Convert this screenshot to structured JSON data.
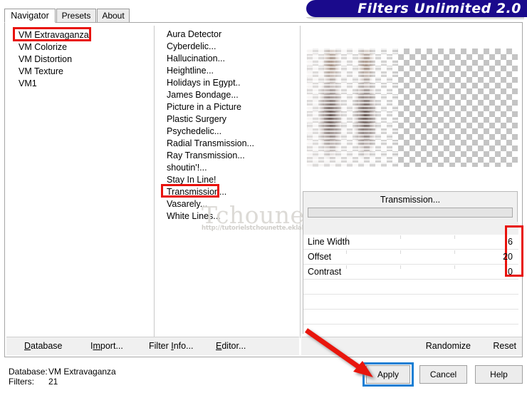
{
  "app": {
    "title": "Filters Unlimited 2.0"
  },
  "tabs": [
    {
      "label": "Navigator",
      "active": true
    },
    {
      "label": "Presets",
      "active": false
    },
    {
      "label": "About",
      "active": false
    }
  ],
  "databases": {
    "items": [
      {
        "label": "VM Extravaganza",
        "selected": true
      },
      {
        "label": "VM Colorize",
        "selected": false
      },
      {
        "label": "VM Distortion",
        "selected": false
      },
      {
        "label": "VM Texture",
        "selected": false
      },
      {
        "label": "VM1",
        "selected": false
      }
    ]
  },
  "filters": {
    "items": [
      {
        "label": "Aura Detector",
        "selected": false
      },
      {
        "label": "Cyberdelic...",
        "selected": false
      },
      {
        "label": "Hallucination...",
        "selected": false
      },
      {
        "label": "Heightline...",
        "selected": false
      },
      {
        "label": "Holidays in Egypt..",
        "selected": false
      },
      {
        "label": "James Bondage...",
        "selected": false
      },
      {
        "label": "Picture in a Picture",
        "selected": false
      },
      {
        "label": "Plastic Surgery",
        "selected": false
      },
      {
        "label": "Psychedelic...",
        "selected": false
      },
      {
        "label": "Radial Transmission...",
        "selected": false
      },
      {
        "label": "Ray Transmission...",
        "selected": false
      },
      {
        "label": "shoutin'!...",
        "selected": false
      },
      {
        "label": "Stay In Line!",
        "selected": false
      },
      {
        "label": "Transmission...",
        "selected": true
      },
      {
        "label": "Vasarely...",
        "selected": false
      },
      {
        "label": "White Lines...",
        "selected": false
      }
    ]
  },
  "preview": {
    "alt": "filtered image preview with transparency checkerboard"
  },
  "watermark": {
    "name": "Tchounette",
    "url": "http://tutorielstchounette.eklablog.com"
  },
  "parameters": {
    "title": "Transmission...",
    "preset_value": "",
    "rows": [
      {
        "label": "Line Width",
        "value": "6"
      },
      {
        "label": "Offset",
        "value": "20"
      },
      {
        "label": "Contrast",
        "value": "0"
      },
      {
        "label": "",
        "value": ""
      },
      {
        "label": "",
        "value": ""
      },
      {
        "label": "",
        "value": ""
      },
      {
        "label": "",
        "value": ""
      }
    ]
  },
  "menu": {
    "database": {
      "pre": "",
      "accel": "D",
      "post": "atabase"
    },
    "import": {
      "pre": "I",
      "accel": "m",
      "post": "port..."
    },
    "filter_info": {
      "pre": "Filter ",
      "accel": "I",
      "post": "nfo..."
    },
    "editor": {
      "pre": "",
      "accel": "E",
      "post": "ditor..."
    },
    "randomize": "Randomize",
    "reset": "Reset"
  },
  "status": {
    "database_key": "Database:",
    "database_value": "VM Extravaganza",
    "filters_key": "Filters:",
    "filters_value": "21"
  },
  "dialog_buttons": {
    "apply": "Apply",
    "cancel": "Cancel",
    "help": "Help"
  },
  "annotations": {
    "highlight_color": "#e8120c",
    "focus_color": "#1b7fd4",
    "arrow_color": "#e8120c"
  },
  "colors": {
    "banner_bg": "#1a0a8c",
    "selection_bg": "#1f6fd0",
    "panel_bg": "#f0f0f0"
  }
}
